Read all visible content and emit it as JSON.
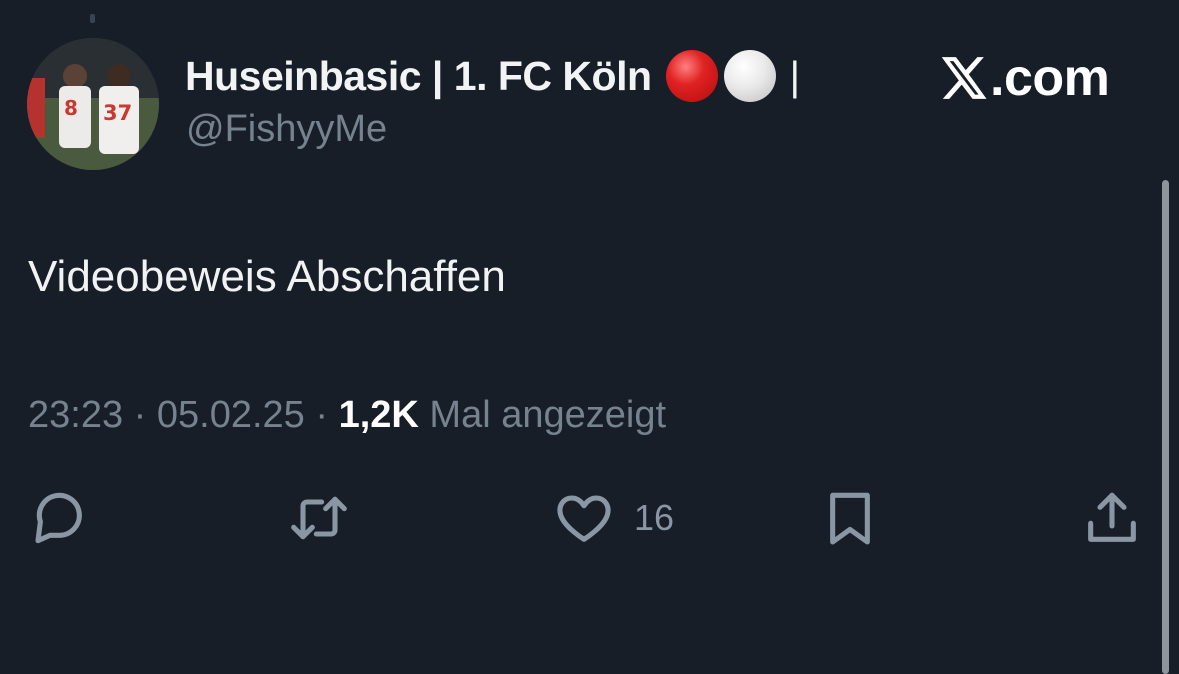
{
  "tweet": {
    "display_name": "Huseinbasic | 1. FC Köln",
    "name_separator": "|",
    "handle": "@FishyyMe",
    "brand": ".com",
    "text": "Videobeweis Abschaffen",
    "time": "23:23",
    "date": "05.02.25",
    "separator": "·",
    "views": "1,2K",
    "views_label": "Mal angezeigt",
    "likes": "16"
  },
  "colors": {
    "background": "#171e28",
    "text": "#e7e9ea",
    "muted": "#76828e",
    "icon": "#8a96a3",
    "red_circle": "#e02222",
    "white_circle": "#e9e9e9"
  },
  "icons": [
    "avatar",
    "x-logo-icon",
    "reply-icon",
    "retweet-icon",
    "heart-icon",
    "bookmark-icon",
    "share-icon"
  ]
}
